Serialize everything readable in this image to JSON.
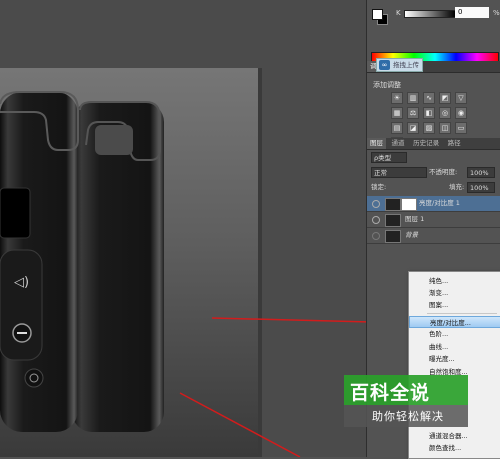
{
  "color_panel": {
    "channel_label": "K",
    "value": "0",
    "unit": "%"
  },
  "tooltip": {
    "text": "拖拽上传"
  },
  "adjustments_panel": {
    "tab_label": "调整",
    "title": "添加调整",
    "icons": [
      "brightness-icon",
      "levels-icon",
      "curves-icon",
      "exposure-icon",
      "vibrance-icon",
      "hue-icon",
      "color-balance-icon",
      "bw-icon",
      "photo-filter-icon",
      "channel-mixer-icon",
      "color-lookup-icon",
      "invert-icon",
      "posterize-icon",
      "threshold-icon",
      "gradient-map-icon",
      "selective-color-icon"
    ]
  },
  "layers_panel": {
    "tabs": [
      "图层",
      "通道",
      "历史记录",
      "路径"
    ],
    "filter_label": "ρ类型",
    "blend_mode": "正常",
    "opacity_label": "不透明度:",
    "opacity_value": "100%",
    "lock_label": "锁定:",
    "fill_label": "填充:",
    "fill_value": "100%",
    "layers": [
      {
        "name": "亮度/对比度 1",
        "selected": true
      },
      {
        "name": "图层 1",
        "selected": false
      },
      {
        "name": "背景",
        "selected": false
      }
    ]
  },
  "context_menu": {
    "items": [
      "纯色...",
      "渐变...",
      "图案...",
      "亮度/对比度...",
      "色阶...",
      "曲线...",
      "曝光度...",
      "自然饱和度...",
      "通道混合器...",
      "颜色查找..."
    ],
    "highlighted": "亮度/对比度..."
  },
  "watermark": {
    "line1": "百科全说",
    "line2": "助你轻松解决"
  },
  "colors": {
    "accent_red": "#d21c1c",
    "selection_blue": "#4d6f94",
    "watermark_green": "#2aa12a"
  }
}
